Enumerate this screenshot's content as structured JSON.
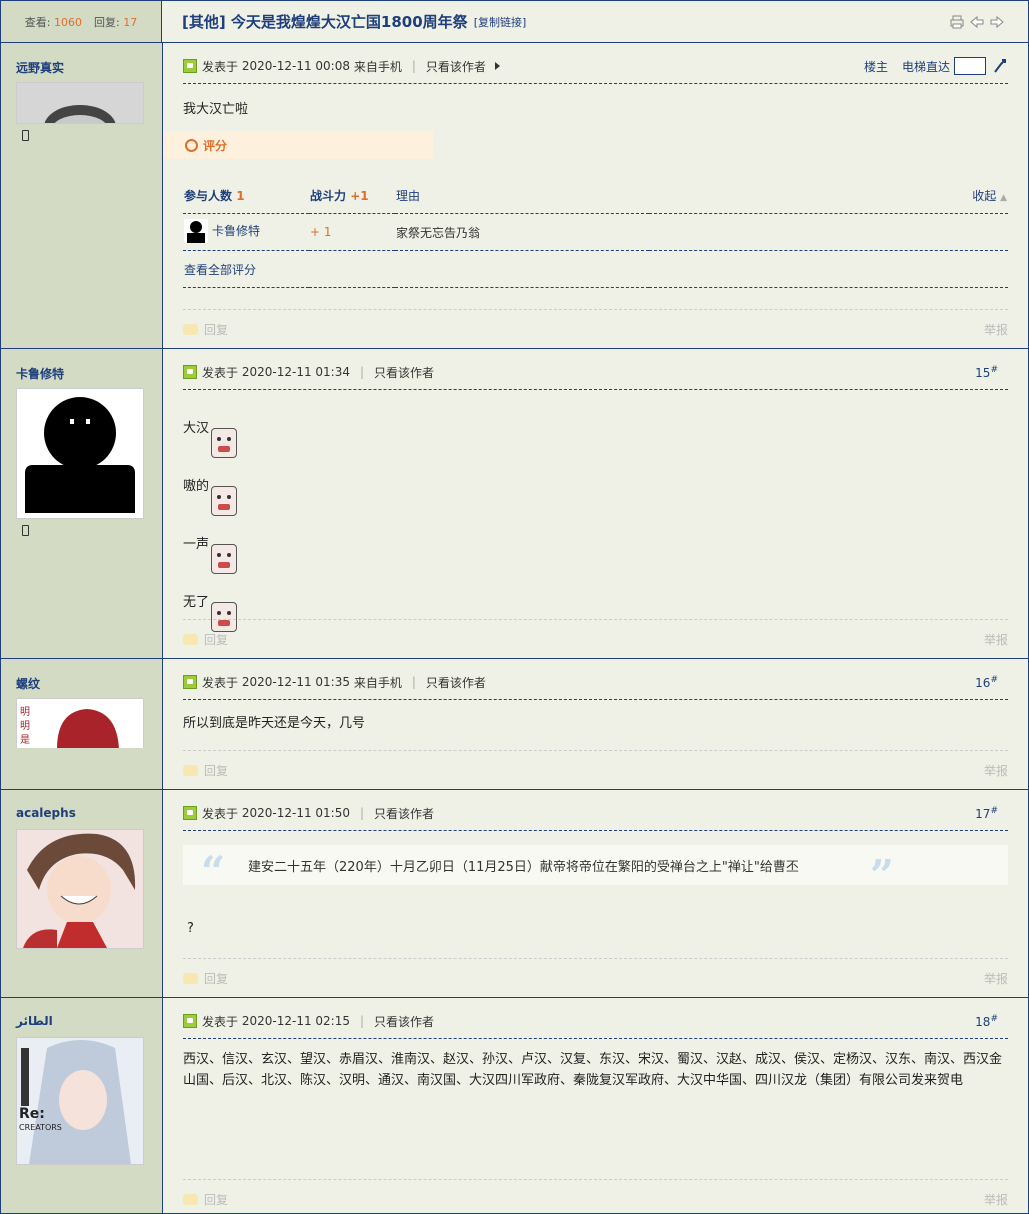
{
  "stats": {
    "views_label": "查看:",
    "views": "1060",
    "replies_label": "回复:",
    "replies": "17"
  },
  "thread": {
    "title": "[其他] 今天是我煌煌大汉亡国1800周年祭",
    "copy_link": "[复制链接]"
  },
  "common": {
    "posted_prefix": "发表于",
    "from_mobile": "来自手机",
    "only_author": "只看该作者",
    "reply": "回复",
    "report": "举报"
  },
  "posts": [
    {
      "user": "远野真实",
      "time": "2020-12-11 00:08",
      "mobile": true,
      "owner_label": "楼主",
      "elevator_label": "电梯直达",
      "content": "我大汉亡啦",
      "rating": {
        "title": "评分",
        "col_people": "参与人数",
        "people": "1",
        "col_power": "战斗力",
        "power": "+1",
        "col_reason": "理由",
        "collapse": "收起",
        "row_user": "卡鲁修特",
        "row_value": "+ 1",
        "row_reason": "家祭无忘告乃翁",
        "view_all": "查看全部评分"
      }
    },
    {
      "user": "卡鲁修特",
      "time": "2020-12-11 01:34",
      "mobile": false,
      "floor": "15",
      "lines": [
        "大汉",
        "嗷的",
        "一声",
        "无了"
      ]
    },
    {
      "user": "螺纹",
      "time": "2020-12-11 01:35",
      "mobile": true,
      "floor": "16",
      "content": "所以到底是昨天还是今天，几号"
    },
    {
      "user": "acalephs",
      "time": "2020-12-11 01:50",
      "mobile": false,
      "floor": "17",
      "quote": "建安二十五年（220年）十月乙卯日（11月25日）献帝将帝位在繁阳的受禅台之上\"禅让\"给曹丕",
      "content": "?"
    },
    {
      "user": "الطائر",
      "time": "2020-12-11 02:15",
      "mobile": false,
      "floor": "18",
      "content": "西汉、信汉、玄汉、望汉、赤眉汉、淮南汉、赵汉、孙汉、卢汉、汉复、东汉、宋汉、蜀汉、汉赵、成汉、侯汉、定杨汉、汉东、南汉、西汉金山国、后汉、北汉、陈汉、汉明、通汉、南汉国、大汉四川军政府、秦陇复汉军政府、大汉中华国、四川汉龙（集团）有限公司发来贺电"
    }
  ],
  "colors": {
    "accent": "#1E3F7A",
    "number": "#E06E2B",
    "sidebar": "#D3DBC4",
    "background": "#F0F1E6"
  },
  "icons": [
    "print-icon",
    "prev-icon",
    "next-icon",
    "mobile-icon",
    "post-icon",
    "reply-icon",
    "arrow-right-icon",
    "jump-icon"
  ]
}
